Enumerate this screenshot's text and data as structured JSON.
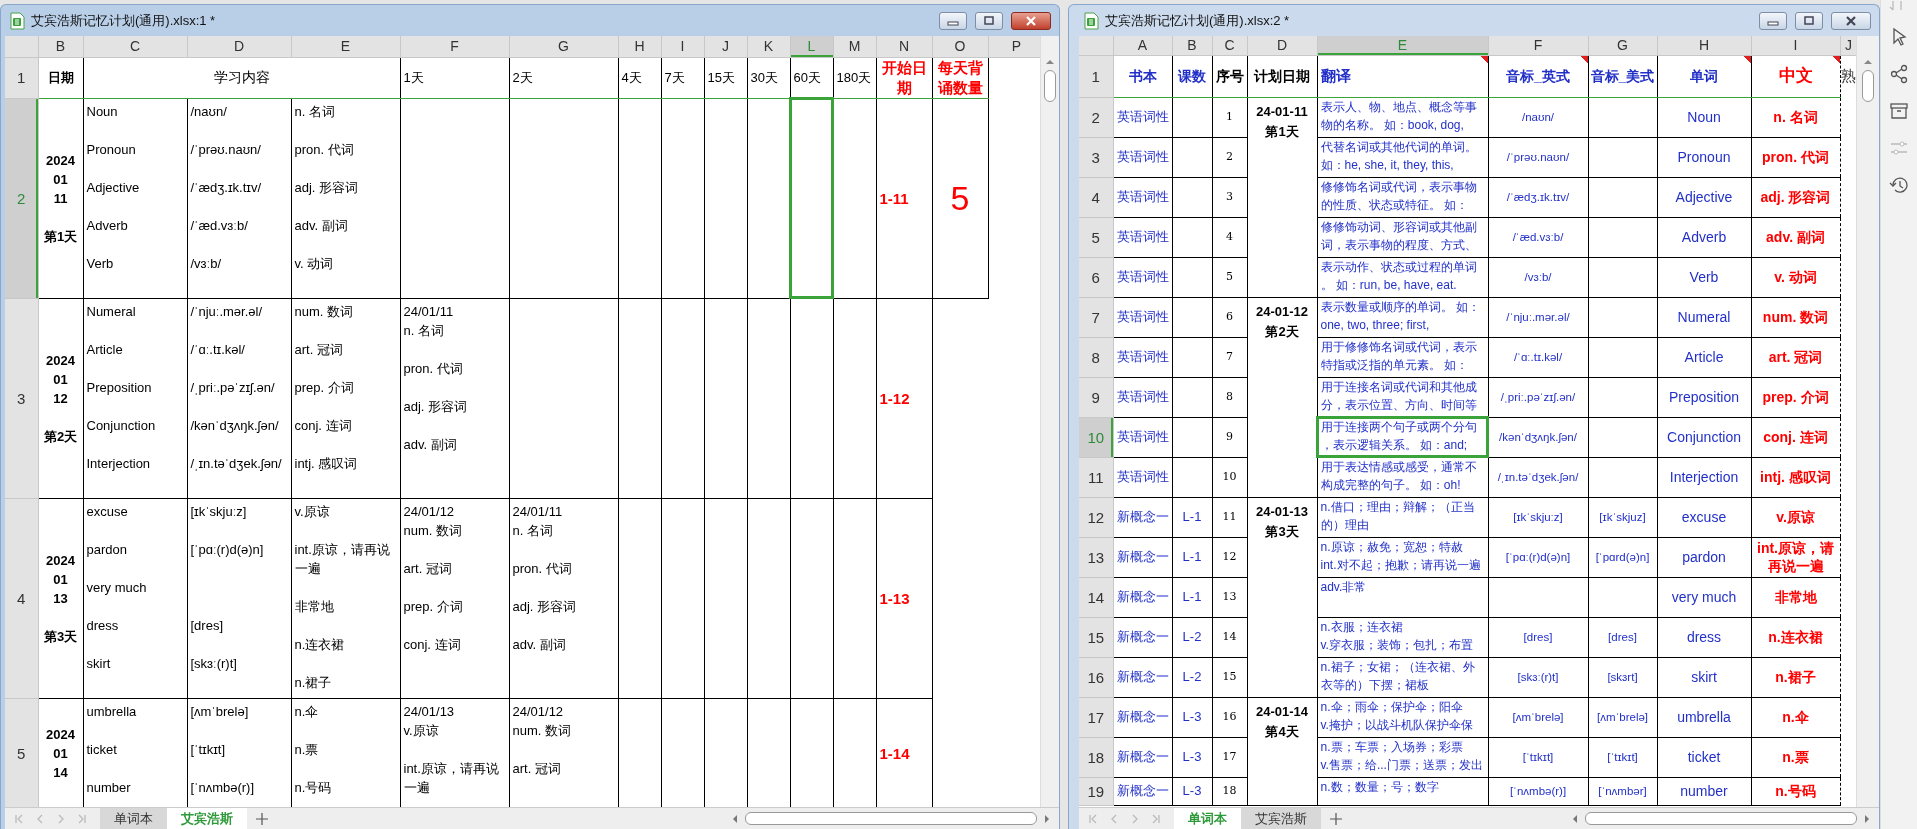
{
  "windows": [
    {
      "title": "艾宾浩斯记忆计划(通用).xlsx:1 *",
      "active": true,
      "column_headers": [
        {
          "label": "B",
          "selected": false
        },
        {
          "label": "C",
          "selected": false
        },
        {
          "label": "D",
          "selected": false
        },
        {
          "label": "E",
          "selected": false
        },
        {
          "label": "F",
          "selected": false
        },
        {
          "label": "G",
          "selected": false
        },
        {
          "label": "H",
          "selected": false
        },
        {
          "label": "I",
          "selected": false
        },
        {
          "label": "J",
          "selected": false
        },
        {
          "label": "K",
          "selected": false
        },
        {
          "label": "L",
          "selected": true
        },
        {
          "label": "M",
          "selected": false
        },
        {
          "label": "N",
          "selected": false
        },
        {
          "label": "O",
          "selected": false
        },
        {
          "label": "P",
          "selected": false
        }
      ],
      "rows": [
        {
          "number": "1",
          "selected": false,
          "kind": "header",
          "cells": [
            {
              "kind": "text",
              "text": "日期"
            },
            {
              "kind": "text",
              "text": "学习内容",
              "colspan": 3
            },
            {
              "kind": "text",
              "text": "1天"
            },
            {
              "kind": "text",
              "text": "2天"
            },
            {
              "kind": "text",
              "text": "4天"
            },
            {
              "kind": "text",
              "text": "7天"
            },
            {
              "kind": "text",
              "text": "15天"
            },
            {
              "kind": "text",
              "text": "30天"
            },
            {
              "kind": "text",
              "text": "60天"
            },
            {
              "kind": "text",
              "text": "180天"
            },
            {
              "kind": "text",
              "text": "开始日期"
            },
            {
              "kind": "text",
              "text": "每天背诵数量"
            },
            null
          ]
        },
        {
          "number": "2",
          "selected": true,
          "kind": "data",
          "cells": [
            {
              "kind": "date",
              "lines": [
                "2024",
                "01",
                "11"
              ],
              "day": "第1天"
            },
            {
              "kind": "list",
              "lines": [
                "Noun",
                "Pronoun",
                "Adjective",
                "Adverb",
                "Verb"
              ]
            },
            {
              "kind": "list",
              "lines": [
                "/naʊn/",
                "/ˈprəʊ.naʊn/",
                "/ˈædʒ.ɪk.tɪv/",
                "/ˈæd.vɜːb/",
                "/vɜːb/"
              ]
            },
            {
              "kind": "list",
              "lines": [
                "n. 名词",
                "pron. 代词",
                "adj. 形容词",
                "adv. 副词",
                "v. 动词"
              ]
            },
            null,
            null,
            null,
            null,
            null,
            null,
            null,
            null,
            {
              "kind": "text",
              "text": "1-11"
            },
            {
              "kind": "text",
              "text": "5"
            },
            null
          ]
        },
        {
          "number": "3",
          "selected": false,
          "kind": "data",
          "cells": [
            {
              "kind": "date",
              "lines": [
                "2024",
                "01",
                "12"
              ],
              "day": "第2天"
            },
            {
              "kind": "list",
              "lines": [
                "Numeral",
                "Article",
                "Preposition",
                "Conjunction",
                "Interjection"
              ]
            },
            {
              "kind": "list",
              "lines": [
                "/ˈnjuː.mər.əl/",
                "/ˈɑː.tɪ.kəl/",
                "/ˌpriː.pəˈzɪʃ.ən/",
                "/kənˈdʒʌŋk.ʃən/",
                "/ˌɪn.təˈdʒek.ʃən/"
              ]
            },
            {
              "kind": "list",
              "lines": [
                "num. 数词",
                "art. 冠词",
                "prep. 介词",
                "conj. 连词",
                "intj. 感叹词"
              ]
            },
            {
              "kind": "review",
              "date": "24/01/11",
              "lines": [
                "n. 名词",
                "pron. 代词",
                "adj. 形容词",
                "adv. 副词"
              ]
            },
            null,
            null,
            null,
            null,
            null,
            null,
            null,
            {
              "kind": "text",
              "text": "1-12"
            },
            null,
            null
          ]
        },
        {
          "number": "4",
          "selected": false,
          "kind": "data",
          "cells": [
            {
              "kind": "date",
              "lines": [
                "2024",
                "01",
                "13"
              ],
              "day": "第3天"
            },
            {
              "kind": "list",
              "lines": [
                "excuse",
                "pardon",
                "very much",
                "dress",
                "skirt"
              ]
            },
            {
              "kind": "list",
              "lines": [
                "[ɪkˈskjuːz]",
                "[ˈpɑː(r)d(ə)n]"
              ],
              "lines_after_gap": [
                "[dres]",
                "[skɜː(r)t]"
              ]
            },
            {
              "kind": "list",
              "lines": [
                "v.原谅",
                "int.原谅，请再说一遍",
                "非常地",
                "n.连衣裙",
                "n.裙子"
              ]
            },
            {
              "kind": "review",
              "date": "24/01/12",
              "lines": [
                "num. 数词",
                "art. 冠词",
                "prep. 介词",
                "conj. 连词"
              ]
            },
            {
              "kind": "review",
              "date": "24/01/11",
              "lines": [
                "n. 名词",
                "pron. 代词",
                "adj. 形容词",
                "adv. 副词"
              ]
            },
            null,
            null,
            null,
            null,
            null,
            null,
            {
              "kind": "text",
              "text": "1-13"
            },
            null,
            null
          ]
        },
        {
          "number": "5",
          "selected": false,
          "kind": "data",
          "cells": [
            {
              "kind": "date",
              "lines": [
                "2024",
                "01",
                "14"
              ]
            },
            {
              "kind": "list",
              "lines": [
                "umbrella",
                "ticket",
                "number"
              ]
            },
            {
              "kind": "list",
              "lines": [
                "[ʌmˈbrelə]",
                "[ˈtɪkɪt]",
                "[ˈnʌmbə(r)]"
              ]
            },
            {
              "kind": "list",
              "lines": [
                "n.伞",
                "n.票",
                "n.号码"
              ]
            },
            {
              "kind": "review",
              "date": "24/01/13",
              "lines": [
                "v.原谅",
                "int.原谅，请再说一遍"
              ]
            },
            {
              "kind": "review",
              "date": "24/01/12",
              "lines": [
                "num. 数词",
                "art. 冠词"
              ]
            },
            null,
            null,
            null,
            null,
            null,
            null,
            {
              "kind": "text",
              "text": "1-14"
            },
            null,
            null
          ]
        }
      ],
      "sheet_tabs": [
        {
          "label": "单词本",
          "selected": false
        },
        {
          "label": "艾宾浩斯",
          "selected": true
        }
      ]
    },
    {
      "title": "艾宾浩斯记忆计划(通用).xlsx:2 *",
      "active": false,
      "column_headers": [
        {
          "label": "A",
          "selected": false
        },
        {
          "label": "B",
          "selected": false
        },
        {
          "label": "C",
          "selected": false
        },
        {
          "label": "D",
          "selected": false
        },
        {
          "label": "E",
          "selected": true
        },
        {
          "label": "F",
          "selected": false
        },
        {
          "label": "G",
          "selected": false
        },
        {
          "label": "H",
          "selected": false
        },
        {
          "label": "I",
          "selected": false
        },
        {
          "label": "J",
          "selected": false
        }
      ],
      "rows": [
        {
          "number": "1",
          "selected": false,
          "kind": "header",
          "cells": [
            {
              "kind": "text",
              "text": "书本",
              "comment": false
            },
            {
              "kind": "text",
              "text": "课数",
              "comment": false
            },
            {
              "kind": "text",
              "text": "序号",
              "comment": false
            },
            {
              "kind": "text",
              "text": "计划日期",
              "comment": false
            },
            {
              "kind": "text",
              "text": "翻译",
              "comment": true
            },
            {
              "kind": "text",
              "text": "音标_英式",
              "comment": true
            },
            {
              "kind": "text",
              "text": "音标_美式",
              "comment": false
            },
            {
              "kind": "text",
              "text": "单词",
              "comment": true
            },
            {
              "kind": "text",
              "text": "中文",
              "comment": true
            },
            {
              "kind": "text",
              "text": "熟",
              "comment": false
            }
          ]
        },
        {
          "number": "2",
          "selected": false,
          "kind": "data",
          "cells": [
            {
              "kind": "text",
              "text": "英语词性"
            },
            null,
            {
              "kind": "text",
              "text": "1"
            },
            {
              "kind": "text",
              "text": "24-01-11\n第1天",
              "rowspan": 5
            },
            {
              "kind": "text",
              "text": "表示人、物、地点、概念等事物的名称。 如：book, dog,"
            },
            {
              "kind": "text",
              "text": "/naʊn/"
            },
            null,
            {
              "kind": "text",
              "text": "Noun"
            },
            {
              "kind": "text",
              "text": "n. 名词"
            },
            null
          ]
        },
        {
          "number": "3",
          "selected": false,
          "kind": "data",
          "cells": [
            {
              "kind": "text",
              "text": "英语词性"
            },
            null,
            {
              "kind": "text",
              "text": "2"
            },
            {
              "kind": "text",
              "text": "代替名词或其他代词的单词。如：he, she, it, they, this,"
            },
            {
              "kind": "text",
              "text": "/ˈprəʊ.naʊn/"
            },
            null,
            {
              "kind": "text",
              "text": "Pronoun"
            },
            {
              "kind": "text",
              "text": "pron. 代词"
            },
            null
          ]
        },
        {
          "number": "4",
          "selected": false,
          "kind": "data",
          "cells": [
            {
              "kind": "text",
              "text": "英语词性"
            },
            null,
            {
              "kind": "text",
              "text": "3"
            },
            {
              "kind": "text",
              "text": "修修饰名词或代词，表示事物的性质、状态或特征。 如："
            },
            {
              "kind": "text",
              "text": "/ˈædʒ.ɪk.tɪv/"
            },
            null,
            {
              "kind": "text",
              "text": "Adjective"
            },
            {
              "kind": "text",
              "text": "adj. 形容词"
            },
            null
          ]
        },
        {
          "number": "5",
          "selected": false,
          "kind": "data",
          "cells": [
            {
              "kind": "text",
              "text": "英语词性"
            },
            null,
            {
              "kind": "text",
              "text": "4"
            },
            {
              "kind": "text",
              "text": "修修饰动词、形容词或其他副词，表示事物的程度、方式、"
            },
            {
              "kind": "text",
              "text": "/ˈæd.vɜːb/"
            },
            null,
            {
              "kind": "text",
              "text": "Adverb"
            },
            {
              "kind": "text",
              "text": "adv. 副词"
            },
            null
          ]
        },
        {
          "number": "6",
          "selected": false,
          "kind": "data",
          "cells": [
            {
              "kind": "text",
              "text": "英语词性"
            },
            null,
            {
              "kind": "text",
              "text": "5"
            },
            {
              "kind": "text",
              "text": "表示动作、状态或过程的单词。 如：run, be, have, eat."
            },
            {
              "kind": "text",
              "text": "/vɜːb/"
            },
            null,
            {
              "kind": "text",
              "text": "Verb"
            },
            {
              "kind": "text",
              "text": "v. 动词"
            },
            null
          ]
        },
        {
          "number": "7",
          "selected": false,
          "kind": "data",
          "cells": [
            {
              "kind": "text",
              "text": "英语词性"
            },
            null,
            {
              "kind": "text",
              "text": "6"
            },
            {
              "kind": "text",
              "text": "24-01-12\n第2天",
              "rowspan": 5
            },
            {
              "kind": "text",
              "text": "表示数量或顺序的单词。 如：\none, two, three; first,"
            },
            {
              "kind": "text",
              "text": "/ˈnjuː.mər.əl/"
            },
            null,
            {
              "kind": "text",
              "text": "Numeral"
            },
            {
              "kind": "text",
              "text": "num. 数词"
            },
            null
          ]
        },
        {
          "number": "8",
          "selected": false,
          "kind": "data",
          "cells": [
            {
              "kind": "text",
              "text": "英语词性"
            },
            null,
            {
              "kind": "text",
              "text": "7"
            },
            {
              "kind": "text",
              "text": "用于修修饰名词或代词，表示特指或泛指的单元素。 如："
            },
            {
              "kind": "text",
              "text": "/ˈɑː.tɪ.kəl/"
            },
            null,
            {
              "kind": "text",
              "text": "Article"
            },
            {
              "kind": "text",
              "text": "art. 冠词"
            },
            null
          ]
        },
        {
          "number": "9",
          "selected": false,
          "kind": "data",
          "cells": [
            {
              "kind": "text",
              "text": "英语词性"
            },
            null,
            {
              "kind": "text",
              "text": "8"
            },
            {
              "kind": "text",
              "text": "用于连接名词或代词和其他成分，表示位置、方向、时间等"
            },
            {
              "kind": "text",
              "text": "/ˌpriː.pəˈzɪʃ.ən/"
            },
            null,
            {
              "kind": "text",
              "text": "Preposition"
            },
            {
              "kind": "text",
              "text": "prep. 介词"
            },
            null
          ]
        },
        {
          "number": "10",
          "selected": true,
          "kind": "data",
          "cells": [
            {
              "kind": "text",
              "text": "英语词性"
            },
            null,
            {
              "kind": "text",
              "text": "9"
            },
            {
              "kind": "text",
              "text": "用于连接两个句子或两个分句，表示逻辑关系。 如：and;"
            },
            {
              "kind": "text",
              "text": "/kənˈdʒʌŋk.ʃən/"
            },
            null,
            {
              "kind": "text",
              "text": "Conjunction"
            },
            {
              "kind": "text",
              "text": "conj. 连词"
            },
            null
          ]
        },
        {
          "number": "11",
          "selected": false,
          "kind": "data",
          "cells": [
            {
              "kind": "text",
              "text": "英语词性"
            },
            null,
            {
              "kind": "text",
              "text": "10"
            },
            {
              "kind": "text",
              "text": "用于表达情感或感受，通常不构成完整的句子。 如：oh!"
            },
            {
              "kind": "text",
              "text": "/ˌɪn.təˈdʒek.ʃən/"
            },
            null,
            {
              "kind": "text",
              "text": "Interjection"
            },
            {
              "kind": "text",
              "text": "intj. 感叹词"
            },
            null
          ]
        },
        {
          "number": "12",
          "selected": false,
          "kind": "data",
          "cells": [
            {
              "kind": "text",
              "text": "新概念一"
            },
            {
              "kind": "text",
              "text": "L-1"
            },
            {
              "kind": "text",
              "text": "11"
            },
            {
              "kind": "text",
              "text": "24-01-13\n第3天",
              "rowspan": 5
            },
            {
              "kind": "text",
              "text": "n.借口；理由；辩解；（正当的）理由"
            },
            {
              "kind": "text",
              "text": "[ɪkˈskjuːz]"
            },
            {
              "kind": "text",
              "text": "[ɪkˈskjuz]"
            },
            {
              "kind": "text",
              "text": "excuse"
            },
            {
              "kind": "text",
              "text": "v.原谅"
            },
            null
          ]
        },
        {
          "number": "13",
          "selected": false,
          "kind": "data",
          "cells": [
            {
              "kind": "text",
              "text": "新概念一"
            },
            {
              "kind": "text",
              "text": "L-1"
            },
            {
              "kind": "text",
              "text": "12"
            },
            {
              "kind": "text",
              "text": "n.原谅；赦免；宽恕；特赦\nint.对不起；抱歉；请再说一遍"
            },
            {
              "kind": "text",
              "text": "[ˈpɑː(r)d(ə)n]"
            },
            {
              "kind": "text",
              "text": "[ˈpɑrd(ə)n]"
            },
            {
              "kind": "text",
              "text": "pardon"
            },
            {
              "kind": "text",
              "text": "int.原谅，请再说一遍"
            },
            null
          ]
        },
        {
          "number": "14",
          "selected": false,
          "kind": "data",
          "cells": [
            {
              "kind": "text",
              "text": "新概念一"
            },
            {
              "kind": "text",
              "text": "L-1"
            },
            {
              "kind": "text",
              "text": "13"
            },
            {
              "kind": "text",
              "text": "adv.非常"
            },
            null,
            null,
            {
              "kind": "text",
              "text": "very much"
            },
            {
              "kind": "text",
              "text": "非常地"
            },
            null
          ]
        },
        {
          "number": "15",
          "selected": false,
          "kind": "data",
          "cells": [
            {
              "kind": "text",
              "text": "新概念一"
            },
            {
              "kind": "text",
              "text": "L-2"
            },
            {
              "kind": "text",
              "text": "14"
            },
            {
              "kind": "text",
              "text": "n.衣服；连衣裙\nv.穿衣服；装饰；包扎；布置"
            },
            {
              "kind": "text",
              "text": "[dres]"
            },
            {
              "kind": "text",
              "text": "[dres]"
            },
            {
              "kind": "text",
              "text": "dress"
            },
            {
              "kind": "text",
              "text": "n.连衣裙"
            },
            null
          ]
        },
        {
          "number": "16",
          "selected": false,
          "kind": "data",
          "cells": [
            {
              "kind": "text",
              "text": "新概念一"
            },
            {
              "kind": "text",
              "text": "L-2"
            },
            {
              "kind": "text",
              "text": "15"
            },
            {
              "kind": "text",
              "text": "n.裙子；女裙；（连衣裙、外衣等的）下摆；裙板"
            },
            {
              "kind": "text",
              "text": "[skɜː(r)t]"
            },
            {
              "kind": "text",
              "text": "[skɜrt]"
            },
            {
              "kind": "text",
              "text": "skirt"
            },
            {
              "kind": "text",
              "text": "n.裙子"
            },
            null
          ]
        },
        {
          "number": "17",
          "selected": false,
          "kind": "data",
          "cells": [
            {
              "kind": "text",
              "text": "新概念一"
            },
            {
              "kind": "text",
              "text": "L-3"
            },
            {
              "kind": "text",
              "text": "16"
            },
            {
              "kind": "text",
              "text": "24-01-14\n第4天",
              "rowspan": 3
            },
            {
              "kind": "text",
              "text": "n.伞；雨伞；保护伞；阳伞\nv.掩护；以战斗机队保护伞保"
            },
            {
              "kind": "text",
              "text": "[ʌmˈbrelə]"
            },
            {
              "kind": "text",
              "text": "[ʌmˈbrelə]"
            },
            {
              "kind": "text",
              "text": "umbrella"
            },
            {
              "kind": "text",
              "text": "n.伞"
            },
            null
          ]
        },
        {
          "number": "18",
          "selected": false,
          "kind": "data",
          "cells": [
            {
              "kind": "text",
              "text": "新概念一"
            },
            {
              "kind": "text",
              "text": "L-3"
            },
            {
              "kind": "text",
              "text": "17"
            },
            {
              "kind": "text",
              "text": "n.票；车票；入场券；彩票\nv.售票；给...门票；送票；发出"
            },
            {
              "kind": "text",
              "text": "[ˈtɪkɪt]"
            },
            {
              "kind": "text",
              "text": "[ˈtɪkɪt]"
            },
            {
              "kind": "text",
              "text": "ticket"
            },
            {
              "kind": "text",
              "text": "n.票"
            },
            null
          ]
        },
        {
          "number": "19",
          "selected": false,
          "kind": "data",
          "cells": [
            {
              "kind": "text",
              "text": "新概念一"
            },
            {
              "kind": "text",
              "text": "L-3"
            },
            {
              "kind": "text",
              "text": "18"
            },
            {
              "kind": "text",
              "text": "n.数；数量；号；数字"
            },
            {
              "kind": "text",
              "text": "[ˈnʌmbə(r)]"
            },
            {
              "kind": "text",
              "text": "[ˈnʌmbər]"
            },
            {
              "kind": "text",
              "text": "number"
            },
            {
              "kind": "text",
              "text": "n.号码"
            },
            null
          ]
        }
      ],
      "sheet_tabs": [
        {
          "label": "单词本",
          "selected": true
        },
        {
          "label": "艾宾浩斯",
          "selected": false
        }
      ]
    }
  ]
}
